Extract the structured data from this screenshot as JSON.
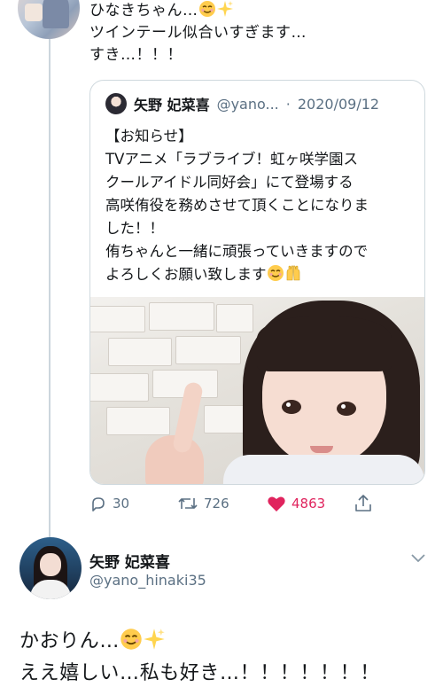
{
  "reply": {
    "line1": "ひなきちゃん…",
    "line1_emojis": [
      "smiling-face-icon",
      "sparkles-icon"
    ],
    "line2": "ツインテール似合いすぎます…",
    "line3": "すき…！！！"
  },
  "quote": {
    "name": "矢野 妃菜喜",
    "handle": "@yano...",
    "separator": "·",
    "date": "2020/09/12",
    "lines": [
      "【お知らせ】",
      "TVアニメ「ラブライブ！虹ヶ咲学園ス",
      "クールアイドル同好会」にて登場する",
      "高咲侑役を務めさせて頂くことになりま",
      "した！！",
      "侑ちゃんと一緒に頑張っていきますので",
      "よろしくお願い致します"
    ],
    "last_line_emojis": [
      "smiling-face-icon",
      "raised-hands-icon"
    ]
  },
  "actions": {
    "reply_count": "30",
    "retweet_count": "726",
    "like_count": "4863"
  },
  "author": {
    "name": "矢野 妃菜喜",
    "handle": "@yano_hinaki35"
  },
  "main": {
    "line1": "かおりん…",
    "line2": "ええ嬉しい…私も好き…！！！！！！！"
  },
  "colors": {
    "like": "#e0245e",
    "secondary_text": "#5b7083",
    "border": "#cfd9de"
  }
}
